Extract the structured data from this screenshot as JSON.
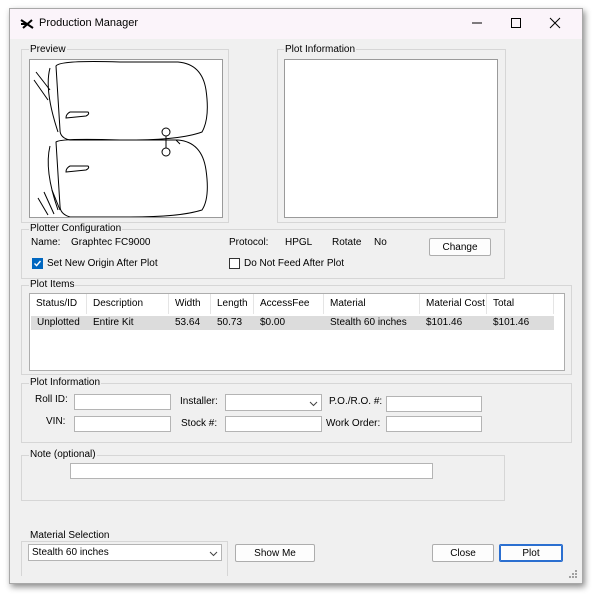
{
  "window": {
    "title": "Production Manager"
  },
  "preview": {
    "label": "Preview"
  },
  "plot_info_box": {
    "label": "Plot Information"
  },
  "plotter": {
    "group_label": "Plotter Configuration",
    "name_label": "Name:",
    "name_value": "Graphtec  FC9000",
    "protocol_label": "Protocol:",
    "protocol_value": "HPGL",
    "rotate_label": "Rotate",
    "rotate_value": "No",
    "change_button": "Change",
    "set_origin_label": "Set New Origin After Plot",
    "set_origin_checked": true,
    "no_feed_label": "Do Not Feed After Plot",
    "no_feed_checked": false
  },
  "plot_items": {
    "group_label": "Plot Items",
    "columns": [
      "Status/ID",
      "Description",
      "Width",
      "Length",
      "AccessFee",
      "Material",
      "Material Cost",
      "Total"
    ],
    "rows": [
      [
        "Unplotted",
        "Entire Kit",
        "53.64",
        "50.73",
        "$0.00",
        "Stealth 60 inches",
        "$101.46",
        "$101.46"
      ]
    ]
  },
  "plot_information": {
    "group_label": "Plot Information",
    "roll_id_label": "Roll ID:",
    "roll_id_value": "",
    "vin_label": "VIN:",
    "vin_value": "",
    "installer_label": "Installer:",
    "installer_value": "",
    "stock_label": "Stock #:",
    "stock_value": "",
    "po_label": "P.O./R.O. #:",
    "po_value": "",
    "work_order_label": "Work Order:",
    "work_order_value": ""
  },
  "note": {
    "group_label": "Note (optional)",
    "value": ""
  },
  "material": {
    "group_label": "Material Selection",
    "selected": "Stealth 60 inches"
  },
  "buttons": {
    "show_me": "Show Me",
    "close": "Close",
    "plot": "Plot"
  },
  "colors": {
    "accent": "#0067c0",
    "titlebar": "#fbf4fa",
    "window_bg": "#f0f0f0"
  }
}
